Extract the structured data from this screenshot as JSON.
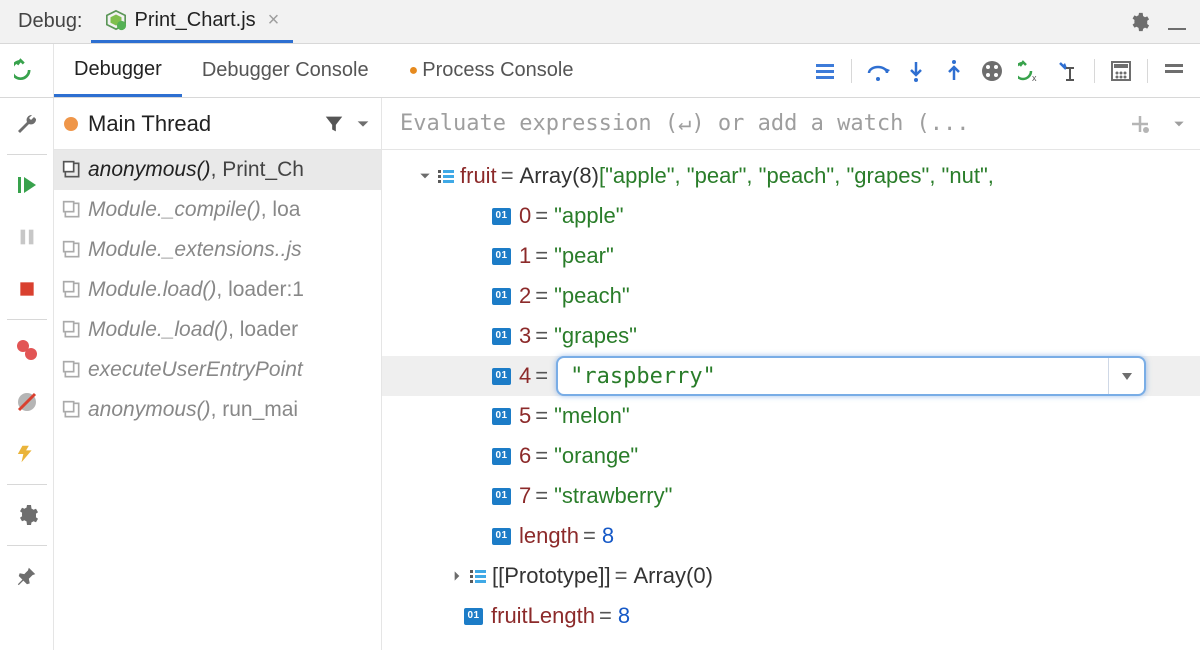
{
  "topbar": {
    "label": "Debug:",
    "tab_title": "Print_Chart.js"
  },
  "subtabs": {
    "debugger": "Debugger",
    "debugger_console": "Debugger Console",
    "process_console": "Process Console"
  },
  "frames_panel": {
    "thread_label": "Main Thread",
    "frames": [
      {
        "fn": "anonymous()",
        "loc": ", Print_Ch",
        "selected": true
      },
      {
        "fn": "Module._compile()",
        "loc": ", loa"
      },
      {
        "fn": "Module._extensions..js",
        "loc": ""
      },
      {
        "fn": "Module.load()",
        "loc": ", loader:1"
      },
      {
        "fn": "Module._load()",
        "loc": ", loader"
      },
      {
        "fn": "executeUserEntryPoint",
        "loc": ""
      },
      {
        "fn": "anonymous()",
        "loc": ", run_mai"
      }
    ]
  },
  "eval": {
    "placeholder": "Evaluate expression (↵) or add a watch (..."
  },
  "vars": {
    "fruit_name": "fruit",
    "fruit_summary": "Array(8) [\"apple\", \"pear\", \"peach\", \"grapes\", \"nut\",",
    "items": {
      "0": "\"apple\"",
      "1": "\"pear\"",
      "2": "\"peach\"",
      "3": "\"grapes\"",
      "4_input": "\"raspberry\"",
      "5": "\"melon\"",
      "6": "\"orange\"",
      "7": "\"strawberry\""
    },
    "length_label": "length",
    "length_value": "8",
    "proto_label": "[[Prototype]]",
    "proto_value": "Array(0)",
    "fruitLength_label": "fruitLength",
    "fruitLength_value": "8"
  }
}
